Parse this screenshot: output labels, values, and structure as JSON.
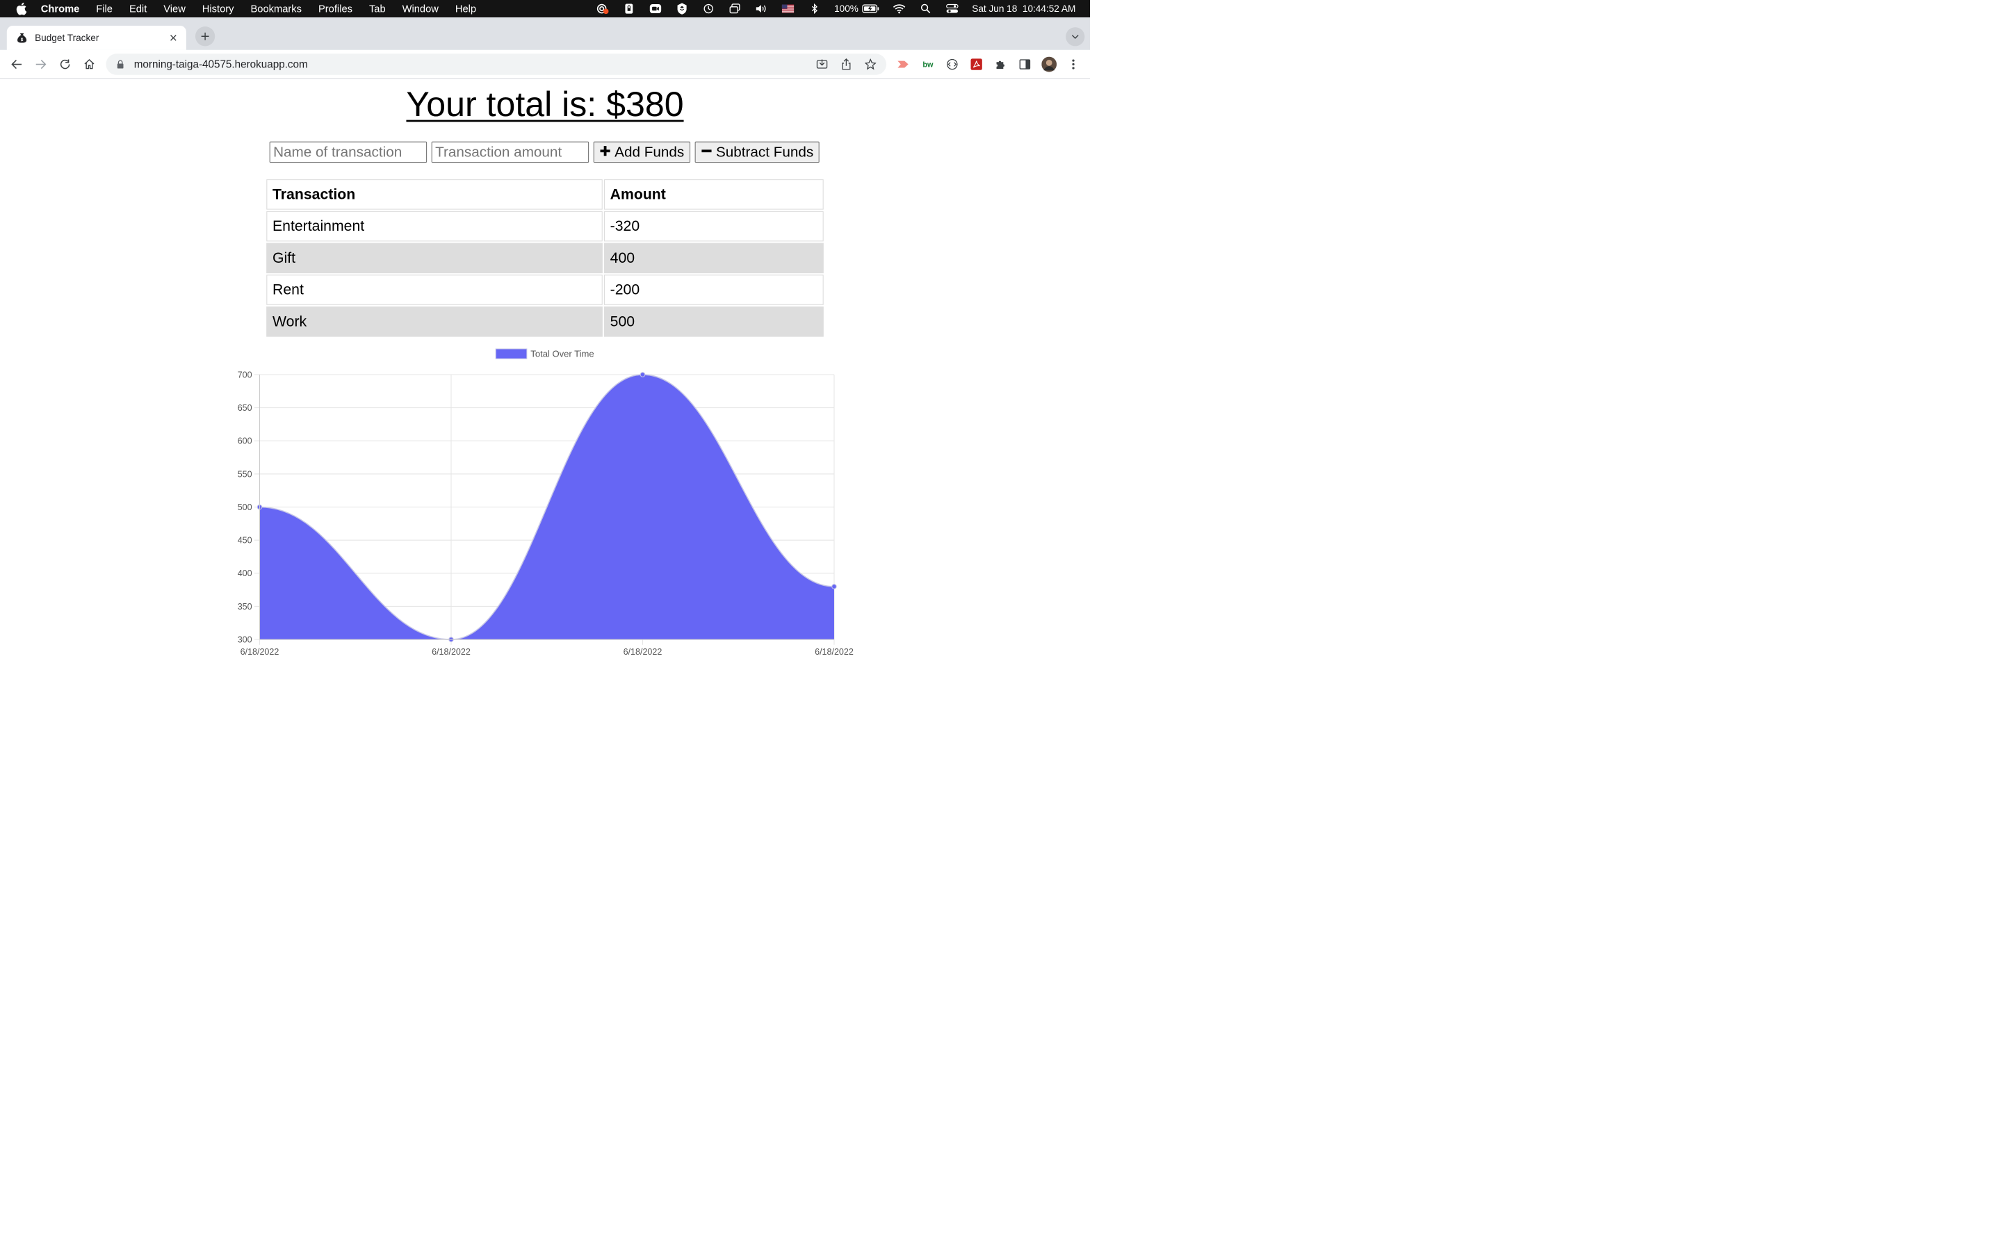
{
  "menubar": {
    "app": "Chrome",
    "items": [
      "File",
      "Edit",
      "View",
      "History",
      "Bookmarks",
      "Profiles",
      "Tab",
      "Window",
      "Help"
    ],
    "battery": "100%",
    "datetime": "Sat Jun 18  10:44:52 AM"
  },
  "browser": {
    "tab_title": "Budget Tracker",
    "url": "morning-taiga-40575.herokuapp.com"
  },
  "page": {
    "total_heading": "Your total is: $380",
    "name_placeholder": "Name of transaction",
    "amount_placeholder": "Transaction amount",
    "add_label": "Add Funds",
    "subtract_label": "Subtract Funds",
    "table": {
      "headers": [
        "Transaction",
        "Amount"
      ],
      "rows": [
        {
          "name": "Entertainment",
          "amount": "-320"
        },
        {
          "name": "Gift",
          "amount": "400"
        },
        {
          "name": "Rent",
          "amount": "-200"
        },
        {
          "name": "Work",
          "amount": "500"
        }
      ]
    }
  },
  "chart_data": {
    "type": "area",
    "x": [
      "6/18/2022",
      "6/18/2022",
      "6/18/2022",
      "6/18/2022"
    ],
    "series": [
      {
        "name": "Total Over Time",
        "values": [
          500,
          300,
          700,
          380
        ],
        "color": "#6666f4"
      }
    ],
    "ylim": [
      300,
      700
    ],
    "yticks": [
      300,
      350,
      400,
      450,
      500,
      550,
      600,
      650,
      700
    ],
    "legend": "top-center",
    "grid": true
  }
}
